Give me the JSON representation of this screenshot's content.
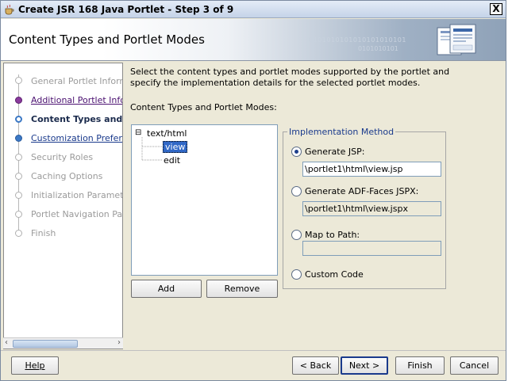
{
  "window": {
    "title": "Create JSR 168 Java Portlet - Step 3 of 9",
    "close_label": "X"
  },
  "banner": {
    "heading": "Content Types and Portlet Modes",
    "binary1": "0101010101010101010101",
    "binary2": "0101010101"
  },
  "steps": [
    {
      "label": "General Portlet Information",
      "state": "disabled"
    },
    {
      "label": "Additional Portlet Information",
      "state": "visited"
    },
    {
      "label": "Content Types and Portlet Modes",
      "state": "current"
    },
    {
      "label": "Customization Preferences",
      "state": "next"
    },
    {
      "label": "Security Roles",
      "state": "disabled"
    },
    {
      "label": "Caching Options",
      "state": "disabled"
    },
    {
      "label": "Initialization Parameters",
      "state": "disabled"
    },
    {
      "label": "Portlet Navigation Parameters",
      "state": "disabled"
    },
    {
      "label": "Finish",
      "state": "disabled"
    }
  ],
  "description": "Select the content types and portlet modes supported by the portlet and specify the implementation details for the selected portlet modes.",
  "content_types_label": "Content Types and Portlet Modes:",
  "tree": {
    "expander": "⊟",
    "root": "text/html",
    "children": [
      "view",
      "edit"
    ],
    "selected": "view"
  },
  "tree_buttons": {
    "add": "Add",
    "remove": "Remove"
  },
  "implementation": {
    "legend": "Implementation Method",
    "options": [
      {
        "label": "Generate JSP:",
        "selected": true,
        "value": "\\portlet1\\html\\view.jsp",
        "field_enabled": true
      },
      {
        "label": "Generate ADF-Faces JSPX:",
        "selected": false,
        "value": "\\portlet1\\html\\view.jspx",
        "field_enabled": false
      },
      {
        "label": "Map to Path:",
        "selected": false,
        "value": "",
        "field_enabled": false
      },
      {
        "label": "Custom Code",
        "selected": false
      }
    ]
  },
  "footer": {
    "help": "Help",
    "back": "< Back",
    "next": "Next >",
    "finish": "Finish",
    "cancel": "Cancel"
  },
  "colors": {
    "accent": "#1a3a8c",
    "visited_link": "#4a1070",
    "window_bg": "#ece9d8"
  }
}
